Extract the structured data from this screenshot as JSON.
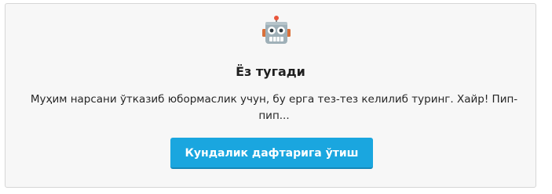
{
  "card": {
    "icon": "robot-icon",
    "title": "Ёз тугади",
    "message": "Муҳим нарсани ўтказиб юбормаслик учун, бу ерга тез-тез келилиб туринг. Хайр! Пип-пип...",
    "button_label": "Кундалик дафтарига ўтиш"
  },
  "colors": {
    "button": "#1aa6df",
    "card_background": "#f7f7f7"
  }
}
